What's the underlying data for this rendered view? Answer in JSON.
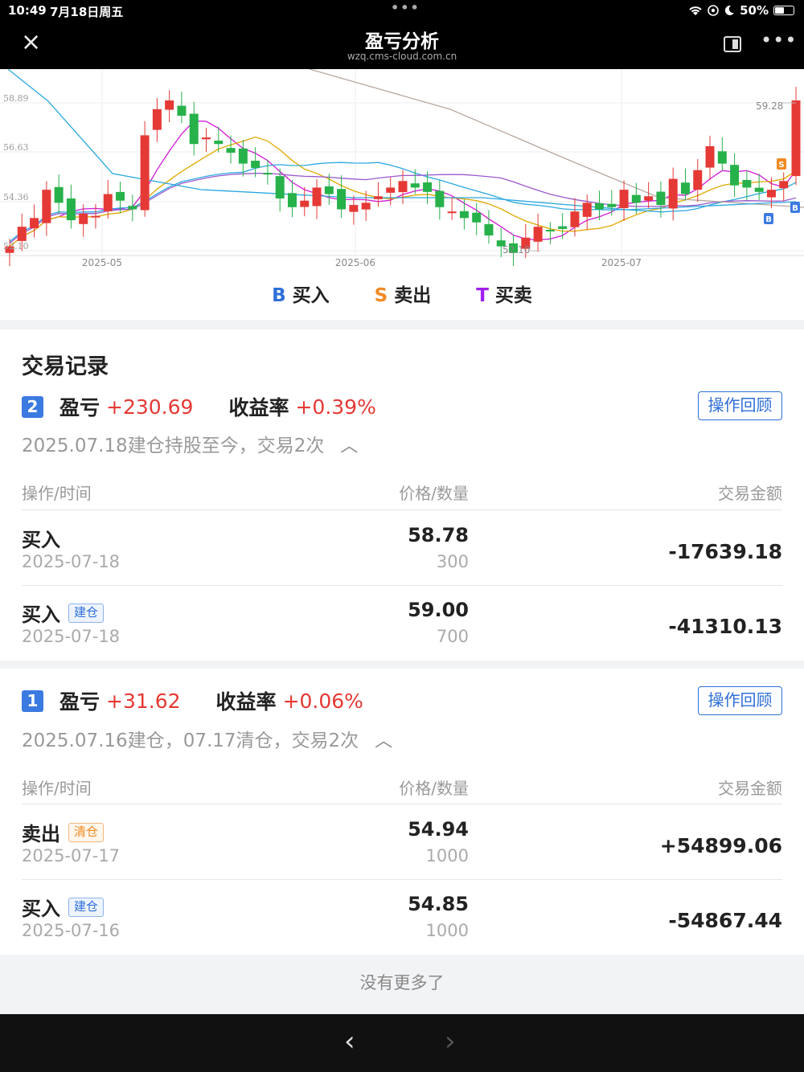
{
  "status": {
    "time": "10:49",
    "date": "7月18日周五",
    "battery": "50%"
  },
  "nav": {
    "close_icon": "×",
    "title": "盈亏分析",
    "subtitle": "wzq.cms-cloud.com.cn"
  },
  "chart_data": {
    "type": "candlestick",
    "y_ticks": [
      "58.89",
      "56.63",
      "54.36",
      "52.10"
    ],
    "x_ticks": [
      "2025-05",
      "2025-06",
      "2025-07"
    ],
    "annotations": {
      "high": "59.28",
      "low": "52.10"
    },
    "markers": [
      {
        "label": "S"
      },
      {
        "label": "B"
      },
      {
        "label": "B"
      }
    ],
    "colors": {
      "up": "#e53935",
      "down": "#27b14a",
      "ma1": "#9b59d0",
      "ma2": "#2aa8e0",
      "ma3": "#e0a800",
      "ma4": "#d21ad8",
      "ma5": "#b9a8a0"
    }
  },
  "legend": [
    {
      "key": "B",
      "label": "买入",
      "color": "#2f6fd8"
    },
    {
      "key": "S",
      "label": "卖出",
      "color": "#f08a24"
    },
    {
      "key": "T",
      "label": "买卖",
      "color": "#a020f0"
    }
  ],
  "records": {
    "title": "交易记录",
    "columns": {
      "op": "操作/时间",
      "price": "价格/数量",
      "amount": "交易金额"
    },
    "review_label": "操作回顾",
    "pnl_label": "盈亏",
    "rate_label": "收益率",
    "trades": [
      {
        "index": "2",
        "pnl": "+230.69",
        "rate": "+0.39%",
        "summary": "2025.07.18建仓持股至今，交易2次",
        "rows": [
          {
            "action": "买入",
            "tag": "",
            "date": "2025-07-18",
            "price": "58.78",
            "qty": "300",
            "amount": "-17639.18"
          },
          {
            "action": "买入",
            "tag": "建仓",
            "date": "2025-07-18",
            "price": "59.00",
            "qty": "700",
            "amount": "-41310.13"
          }
        ]
      },
      {
        "index": "1",
        "pnl": "+31.62",
        "rate": "+0.06%",
        "summary": "2025.07.16建仓，07.17清仓，交易2次",
        "rows": [
          {
            "action": "卖出",
            "tag": "清仓",
            "date": "2025-07-17",
            "price": "54.94",
            "qty": "1000",
            "amount": "+54899.06"
          },
          {
            "action": "买入",
            "tag": "建仓",
            "date": "2025-07-16",
            "price": "54.85",
            "qty": "1000",
            "amount": "-54867.44"
          }
        ]
      }
    ]
  },
  "footer": {
    "no_more": "没有更多了"
  },
  "bottom": {
    "back_icon": "‹",
    "forward_icon": "›"
  }
}
